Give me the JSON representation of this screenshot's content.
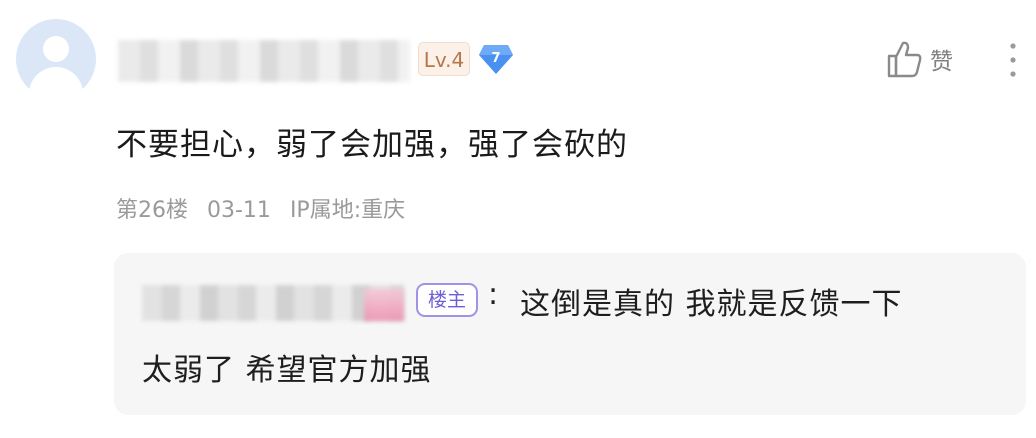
{
  "comment": {
    "level_badge": "Lv.4",
    "vip_badge": "7",
    "text": "不要担心，弱了会加强，强了会砍的",
    "floor": "第26楼",
    "date": "03-11",
    "ip_location": "IP属地:重庆",
    "like_label": "赞"
  },
  "reply": {
    "owner_badge": "楼主",
    "separator": ":",
    "text_line1": "这倒是真的 我就是反馈一下",
    "text_line2": "太弱了 希望官方加强"
  },
  "colors": {
    "level_badge": "#b8774a",
    "vip_badge": "#4a90f0",
    "owner_badge": "#6d5fd6",
    "meta_text": "#9a9a9a",
    "reply_bg": "#f6f6f6"
  },
  "icons": [
    "avatar",
    "diamond-vip-icon",
    "thumbs-up-icon",
    "more-vertical-icon"
  ]
}
